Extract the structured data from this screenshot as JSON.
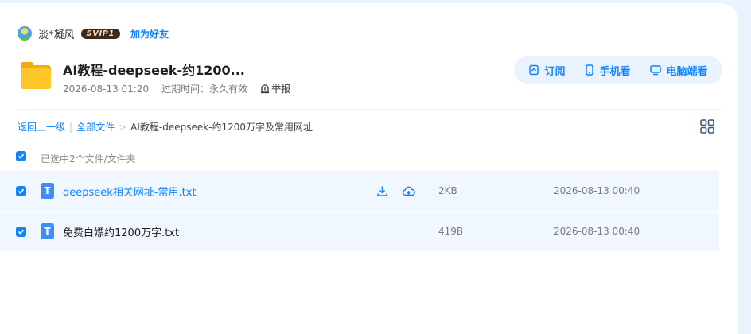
{
  "owner": {
    "name": "淡*凝风",
    "vip_badge": "SVIP1",
    "add_friend": "加为好友"
  },
  "share": {
    "title": "AI教程-deepseek-约1200...",
    "created": "2026-08-13 01:20",
    "expire_label": "过期时间：",
    "expire_value": "永久有效",
    "report": "举报"
  },
  "actions": {
    "subscribe": "订阅",
    "mobile": "手机看",
    "desktop": "电脑端看"
  },
  "breadcrumb": {
    "back": "返回上一级",
    "sep": "|",
    "all_files": "全部文件",
    "arrow": ">",
    "current": "AI教程-deepseek-约1200万字及常用网址"
  },
  "list": {
    "selected_text": "已选中2个文件/文件夹",
    "files": [
      {
        "icon": "T",
        "name": "deepseek相关网址-常用.txt",
        "size": "2KB",
        "time": "2026-08-13 00:40"
      },
      {
        "icon": "T",
        "name": "免费白嫖约1200万字.txt",
        "size": "419B",
        "time": "2026-08-13 00:40"
      }
    ]
  },
  "colors": {
    "accent": "#0d84ff",
    "row_bg": "#f0f7fe",
    "page_bg": "#eaf3fd",
    "folder": "#ffc629",
    "txt_icon": "#3f8ef7"
  }
}
